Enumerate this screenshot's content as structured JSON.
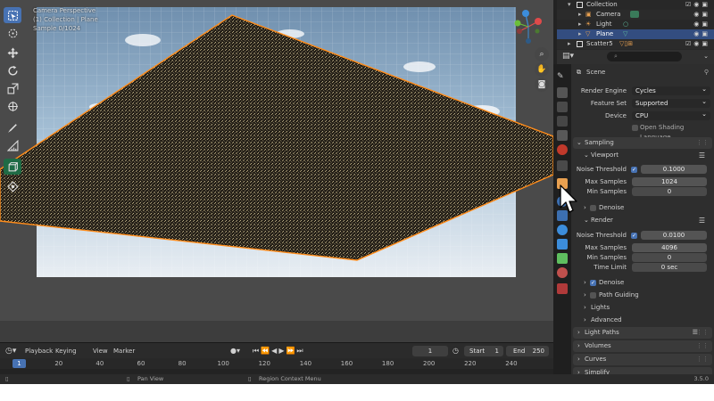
{
  "viewport": {
    "overlay_line1": "Camera Perspective",
    "overlay_line2": "(1) Collection | Plane",
    "overlay_line3": "Sample 0/1024"
  },
  "toolbar_icons": [
    "select-box-icon",
    "cursor-icon",
    "move-icon",
    "rotate-icon",
    "scale-icon",
    "transform-icon",
    "annotate-icon",
    "measure-icon",
    "add-cube-icon",
    "scatter-icon"
  ],
  "timeline": {
    "menu_playback": "Playback",
    "menu_keying": "Keying",
    "menu_view": "View",
    "menu_marker": "Marker",
    "current_frame": "1",
    "start_label": "Start",
    "start_value": "1",
    "end_label": "End",
    "end_value": "250",
    "ruler_current": "1",
    "ruler_ticks": [
      "20",
      "40",
      "60",
      "80",
      "100",
      "120",
      "140",
      "160",
      "180",
      "200",
      "220",
      "240"
    ]
  },
  "statusbar": {
    "pan_view": "Pan View",
    "region_context_menu": "Region Context Menu",
    "version": "3.5.0"
  },
  "outliner": {
    "collection": "Collection",
    "camera": "Camera",
    "light": "Light",
    "plane": "Plane",
    "scatter": "Scatter5"
  },
  "properties": {
    "scene_label": "Scene",
    "render_engine_label": "Render Engine",
    "render_engine_value": "Cycles",
    "feature_set_label": "Feature Set",
    "feature_set_value": "Supported",
    "device_label": "Device",
    "device_value": "CPU",
    "open_shading_language": "Open Shading Language",
    "sampling": "Sampling",
    "viewport": "Viewport",
    "vp_noise_threshold_label": "Noise Threshold",
    "vp_noise_threshold_value": "0.1000",
    "vp_max_samples_label": "Max Samples",
    "vp_max_samples_value": "1024",
    "vp_min_samples_label": "Min Samples",
    "vp_min_samples_value": "0",
    "vp_denoise": "Denoise",
    "render": "Render",
    "r_noise_threshold_label": "Noise Threshold",
    "r_noise_threshold_value": "0.0100",
    "r_max_samples_label": "Max Samples",
    "r_max_samples_value": "4096",
    "r_min_samples_label": "Min Samples",
    "r_min_samples_value": "0",
    "r_time_limit_label": "Time Limit",
    "r_time_limit_value": "0 sec",
    "r_denoise": "Denoise",
    "path_guiding": "Path Guiding",
    "lights": "Lights",
    "advanced": "Advanced",
    "light_paths": "Light Paths",
    "volumes": "Volumes",
    "curves": "Curves",
    "simplify": "Simplify"
  },
  "colors": {
    "accent": "#4772b3",
    "selection": "#334d80",
    "plane_outline": "#ff8c1a"
  }
}
